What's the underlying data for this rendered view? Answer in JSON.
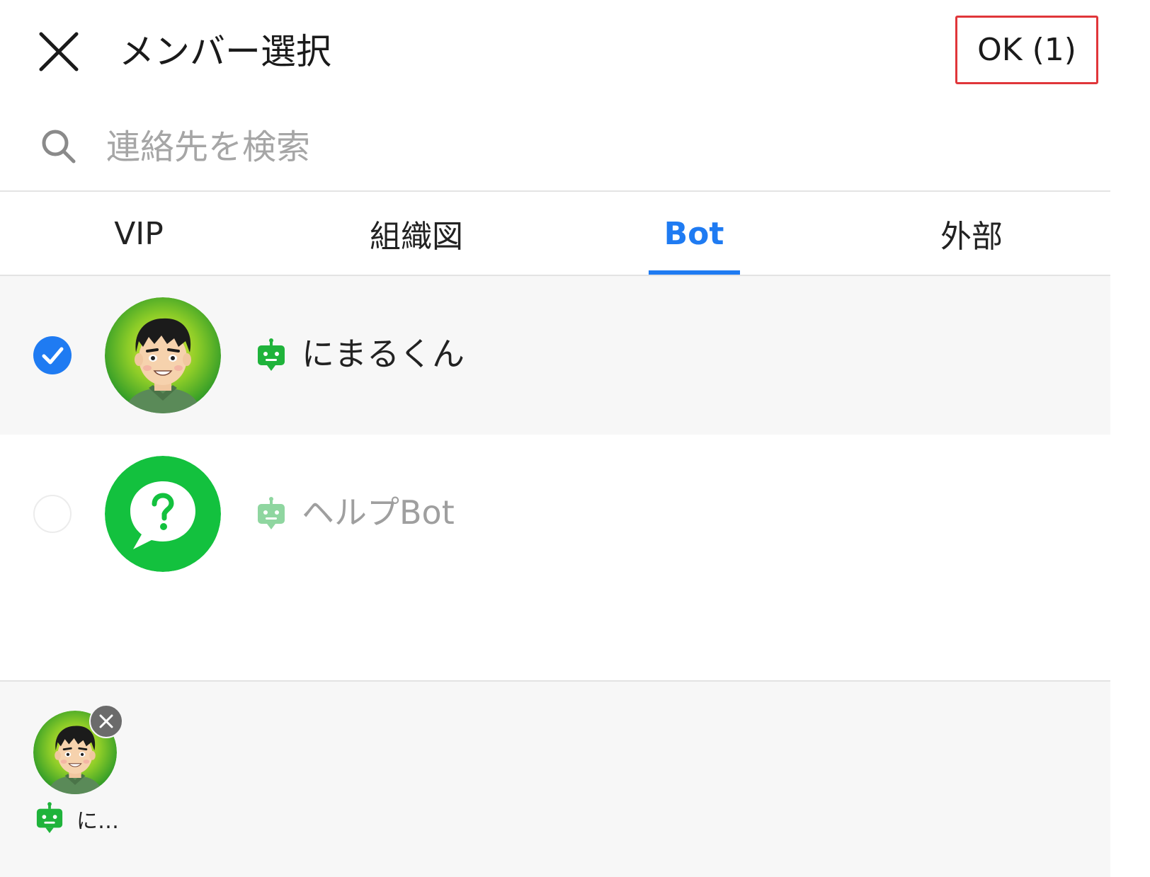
{
  "header": {
    "title": "メンバー選択",
    "ok_label": "OK (1)"
  },
  "search": {
    "placeholder": "連絡先を検索"
  },
  "tabs": [
    {
      "label": "VIP",
      "active": false
    },
    {
      "label": "組織図",
      "active": false
    },
    {
      "label": "Bot",
      "active": true
    },
    {
      "label": "外部",
      "active": false
    }
  ],
  "members": [
    {
      "name": "にまるくん",
      "selected": true,
      "avatar": "cartoon-man-avatar"
    },
    {
      "name": "ヘルプBot",
      "selected": false,
      "avatar": "help-bot-avatar"
    }
  ],
  "selected_tray": [
    {
      "name": "に…",
      "avatar": "cartoon-man-avatar"
    }
  ],
  "colors": {
    "accent": "#1f7bf2",
    "ok_border": "#e0363a",
    "bot_green": "#1fb33b",
    "help_bot_green": "#13c13e"
  },
  "icons": {
    "close": "close-icon",
    "search": "search-icon",
    "bot": "bot-icon",
    "check": "check-icon",
    "remove": "remove-icon"
  }
}
